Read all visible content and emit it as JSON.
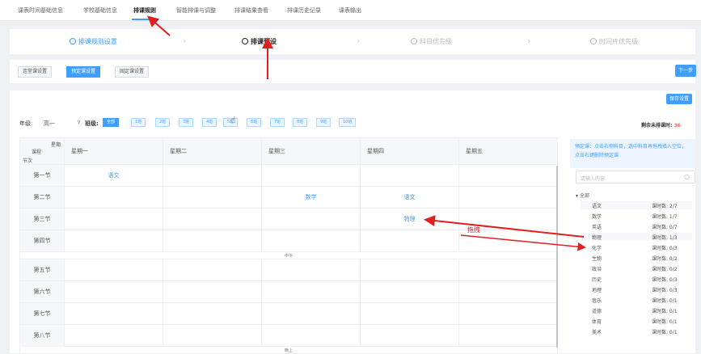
{
  "top_nav": {
    "tabs": [
      "课表时间基础信息",
      "学校基础信息",
      "排课规则",
      "智能排课与调整",
      "排课结果查看",
      "排课历史记录",
      "课表输出"
    ]
  },
  "steps": [
    "排课规则设置",
    "排课预设",
    "科目优先级",
    "时间片优先级"
  ],
  "subtabs": [
    "连堂课设置",
    "预定课设置",
    "固定课设置"
  ],
  "next_button": "下一步",
  "save_button": "保存设置",
  "filter": {
    "grade_label": "年级:",
    "grade_value": "高一",
    "class_label": "班级:",
    "classes": [
      "全部",
      "1班",
      "2班",
      "3班",
      "4班",
      "5班",
      "6班",
      "7班",
      "8班",
      "9班",
      "10班"
    ]
  },
  "remaining": {
    "label": "剩余未排课时:",
    "value": "36"
  },
  "grid": {
    "corner": {
      "week": "星期",
      "course": "课程",
      "period": "节次"
    },
    "days": [
      "星期一",
      "星期二",
      "星期三",
      "星期四",
      "星期五"
    ],
    "periods": [
      "第一节",
      "第二节",
      "第三节",
      "第四节",
      "第五节",
      "第六节",
      "第七节",
      "第八节"
    ],
    "noon_label": "中午",
    "evening_label": "晚上",
    "cells": [
      [
        "语文",
        "",
        "",
        "",
        ""
      ],
      [
        "",
        "",
        "数学",
        "语文",
        ""
      ],
      [
        "",
        "",
        "",
        "物理",
        ""
      ],
      [
        "",
        "",
        "",
        "",
        ""
      ],
      [
        "",
        "",
        "",
        "",
        ""
      ],
      [
        "",
        "",
        "",
        "",
        ""
      ],
      [
        "",
        "",
        "",
        "",
        ""
      ],
      [
        "",
        "",
        "",
        "",
        ""
      ]
    ]
  },
  "hint": "预定课：点击右侧科目，选中科目再拖拽填入空位，点击右键删除预定课",
  "search_placeholder": "请输入内容",
  "tree_root": "全部",
  "subjects": [
    {
      "name": "语文",
      "count": "课时数: 2/7"
    },
    {
      "name": "数学",
      "count": "课时数: 1/7"
    },
    {
      "name": "英语",
      "count": "课时数: 0/7"
    },
    {
      "name": "物理",
      "count": "课时数: 1/3"
    },
    {
      "name": "化学",
      "count": "课时数: 0/3"
    },
    {
      "name": "生物",
      "count": "课时数: 0/2"
    },
    {
      "name": "政治",
      "count": "课时数: 0/2"
    },
    {
      "name": "历史",
      "count": "课时数: 0/3"
    },
    {
      "name": "地理",
      "count": "课时数: 0/3"
    },
    {
      "name": "音乐",
      "count": "课时数: 0/1"
    },
    {
      "name": "道德",
      "count": "课时数: 0/1"
    },
    {
      "name": "体育",
      "count": "课时数: 0/1"
    },
    {
      "name": "美术",
      "count": "课时数: 0/1"
    }
  ],
  "annotation": "拖拽",
  "colors": {
    "accent": "#409eff",
    "annotation": "#e02020",
    "remaining": "#f56c6c"
  }
}
